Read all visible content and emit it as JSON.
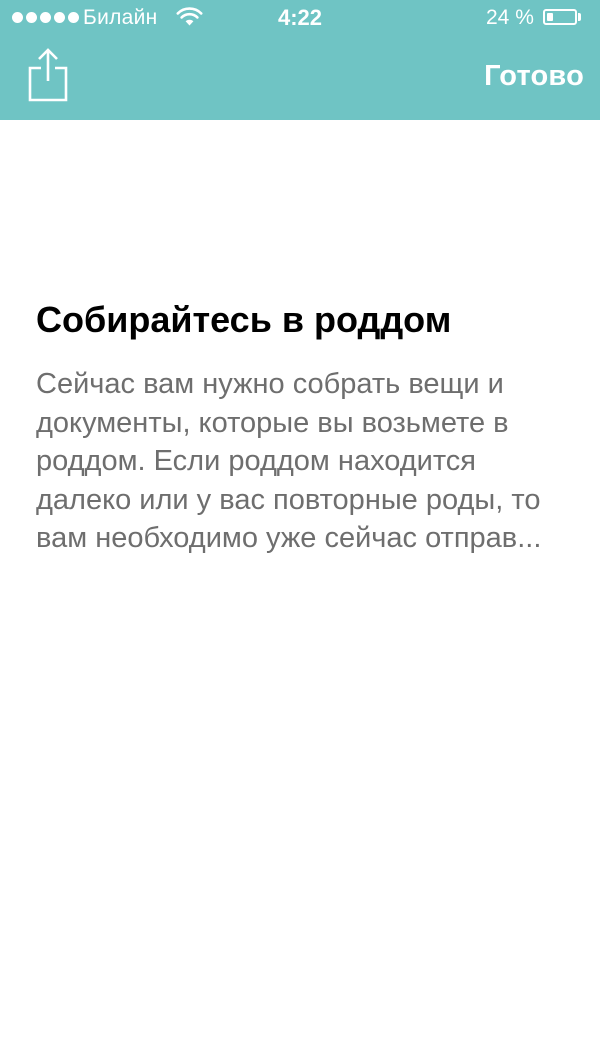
{
  "status_bar": {
    "carrier": "Билайн",
    "time": "4:22",
    "battery_percent_label": "24 %",
    "battery_level": 0.24,
    "signal_bars": 5
  },
  "nav_bar": {
    "share_icon": "share-icon",
    "done_label": "Готово",
    "background_color": "#6fc4c4"
  },
  "article": {
    "title": "Собирайтесь в роддом",
    "body": "Сейчас вам нужно собрать вещи и документы, которые вы возьмете в роддом. Если роддом находится далеко или у вас повторные роды, то вам необходимо уже сейчас отправ..."
  }
}
